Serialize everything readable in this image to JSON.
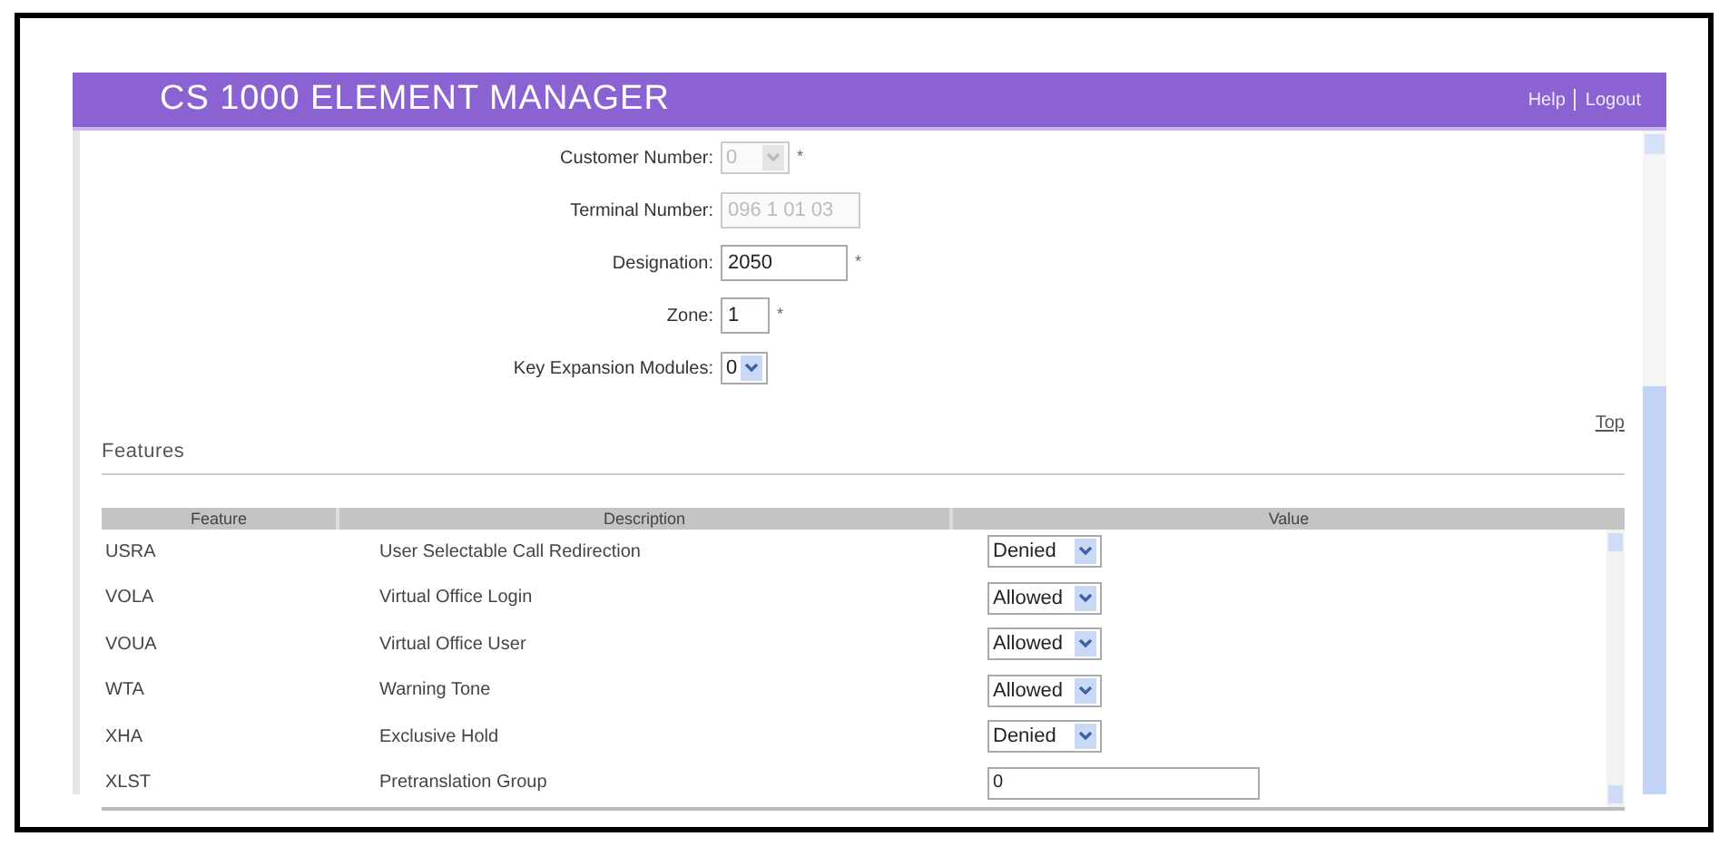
{
  "header": {
    "title": "CS 1000 ELEMENT MANAGER",
    "links": [
      "Help",
      "Logout"
    ]
  },
  "form": [
    {
      "label": "Customer Number:",
      "kind": "select",
      "value": "0",
      "disabled": true,
      "mark": "*"
    },
    {
      "label": "Terminal Number:",
      "kind": "text",
      "value": "096 1 01 03",
      "disabled": true
    },
    {
      "label": "Designation:",
      "kind": "text",
      "value": "2050",
      "disabled": false,
      "mark": "*"
    },
    {
      "label": "Zone:",
      "kind": "text",
      "value": "1",
      "disabled": false,
      "mark": "*"
    },
    {
      "label": "Key Expansion Modules:",
      "kind": "select",
      "value": "0",
      "disabled": false
    }
  ],
  "top_link": "Top",
  "section_title": "Features",
  "table": {
    "columns": [
      "Feature",
      "Description",
      "Value"
    ],
    "rows": [
      {
        "feature": "USRA",
        "description": "User Selectable Call Redirection",
        "kind": "select",
        "value": "Denied"
      },
      {
        "feature": "VOLA",
        "description": "Virtual Office Login",
        "kind": "select",
        "value": "Allowed"
      },
      {
        "feature": "VOUA",
        "description": "Virtual Office User",
        "kind": "select",
        "value": "Allowed"
      },
      {
        "feature": "WTA",
        "description": "Warning Tone",
        "kind": "select",
        "value": "Allowed"
      },
      {
        "feature": "XHA",
        "description": "Exclusive Hold",
        "kind": "select",
        "value": "Denied"
      },
      {
        "feature": "XLST",
        "description": "Pretranslation Group",
        "kind": "text",
        "value": "0"
      }
    ]
  }
}
